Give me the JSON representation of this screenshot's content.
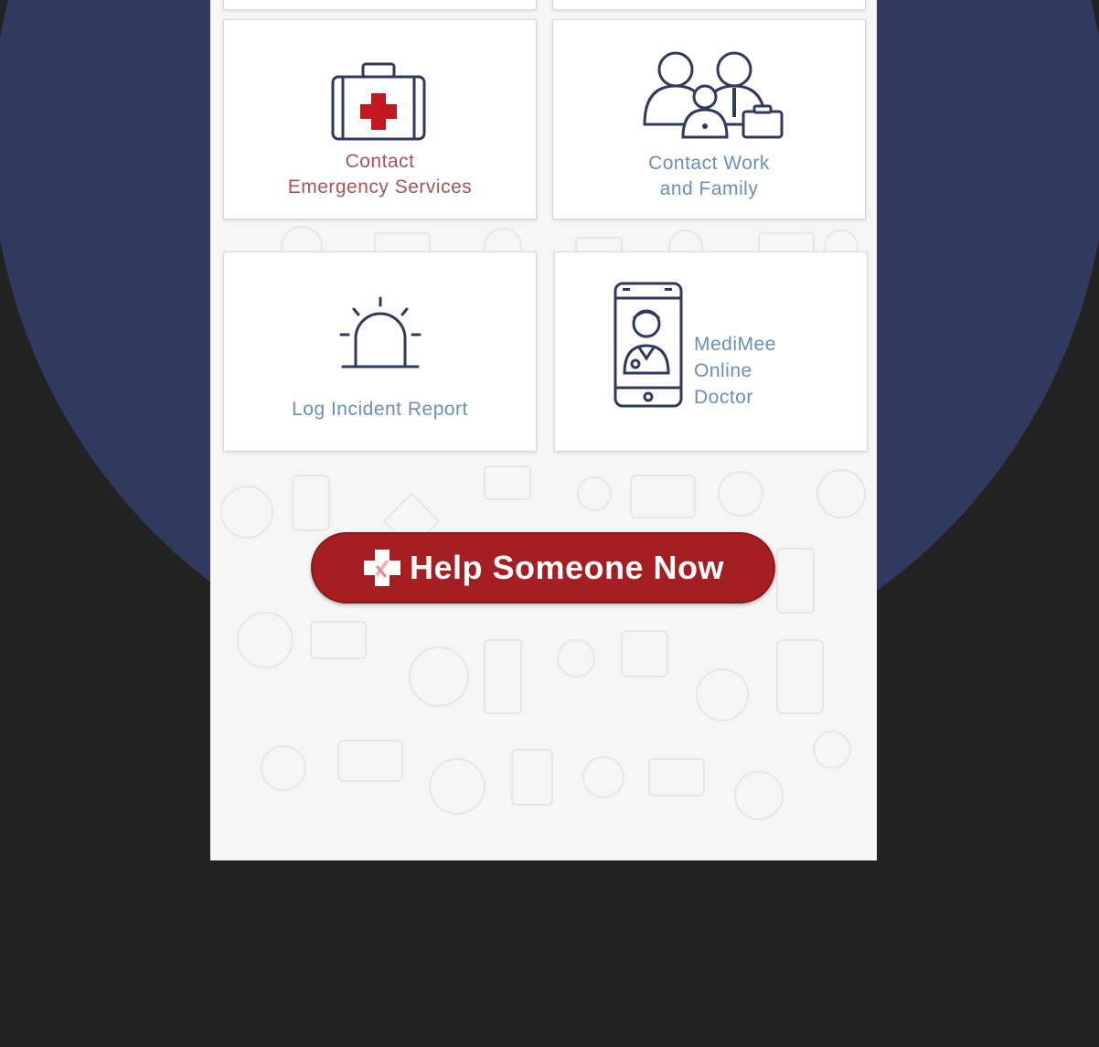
{
  "tiles": {
    "emergency": {
      "line1": "Contact",
      "line2": "Emergency Services",
      "icon": "first-aid-kit-icon"
    },
    "work_family": {
      "line1": "Contact Work",
      "line2": "and Family",
      "icon": "family-group-icon"
    },
    "incident": {
      "label": "Log Incident Report",
      "icon": "siren-light-icon"
    },
    "doctor": {
      "line1": "MediMee",
      "line2": "Online",
      "line3": "Doctor",
      "icon": "phone-doctor-icon"
    }
  },
  "help_button": {
    "label": "Help Someone Now",
    "icon": "medical-cross-icon"
  },
  "colors": {
    "background": "#222222",
    "circle": "#2f3a5e",
    "accent_red": "#a41e22",
    "text_red": "#a45656",
    "text_blue": "#6a8fb8",
    "icon_navy": "#2d3a5c"
  }
}
